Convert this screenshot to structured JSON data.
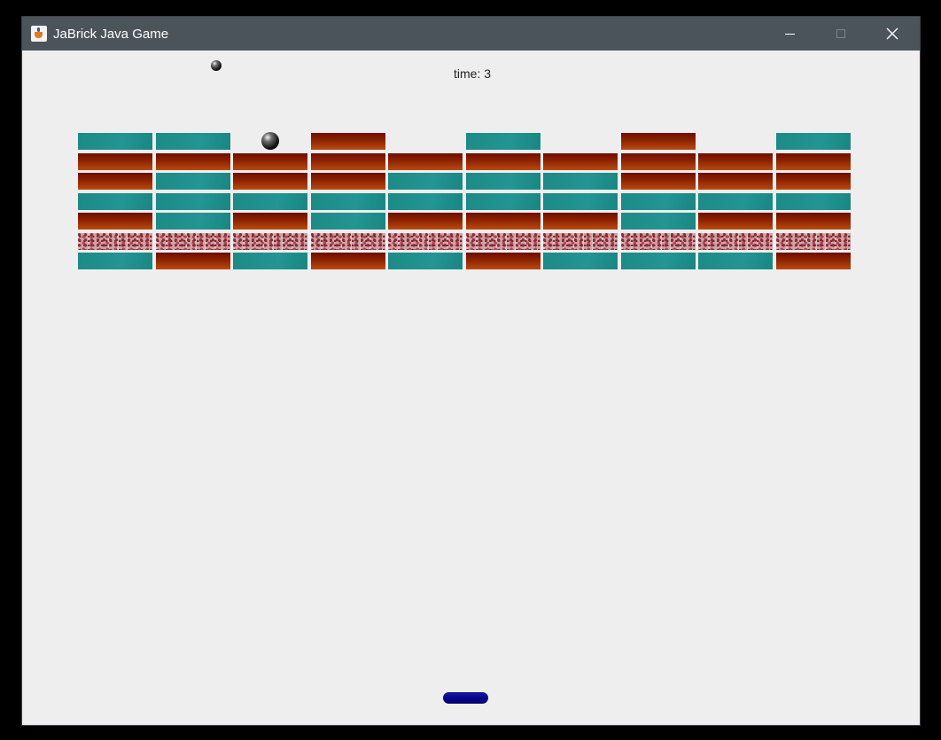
{
  "window": {
    "title": "JaBrick Java Game",
    "icon": "java-cup-icon"
  },
  "controls": {
    "minimize": "minimize-icon",
    "maximize": "maximize-icon",
    "close": "close-icon"
  },
  "hud": {
    "time_text": "time: 3"
  },
  "colors": {
    "teal_brick": "#1f908d",
    "red_brick": "#8e2400",
    "granite_brick": "#cfa3a6",
    "paddle": "#050589",
    "background": "#eeeeee",
    "titlebar": "#4b545a"
  },
  "bricks": {
    "columns": 10,
    "rows": [
      [
        "teal",
        "teal",
        "",
        "red",
        "",
        "teal",
        "",
        "red",
        "",
        "teal"
      ],
      [
        "red",
        "red",
        "red",
        "red",
        "red",
        "red",
        "red",
        "red",
        "red",
        "red"
      ],
      [
        "red",
        "teal",
        "red",
        "red",
        "teal",
        "teal",
        "teal",
        "red",
        "red",
        "red"
      ],
      [
        "teal",
        "teal",
        "teal",
        "teal",
        "teal",
        "teal",
        "teal",
        "teal",
        "teal",
        "teal"
      ],
      [
        "red",
        "teal",
        "red",
        "teal",
        "red",
        "red",
        "red",
        "teal",
        "red",
        "red"
      ],
      [
        "granite",
        "granite",
        "granite",
        "granite",
        "granite",
        "granite",
        "granite",
        "granite",
        "granite",
        "granite"
      ],
      [
        "teal",
        "red",
        "teal",
        "red",
        "teal",
        "red",
        "teal",
        "teal",
        "teal",
        "red"
      ]
    ]
  }
}
